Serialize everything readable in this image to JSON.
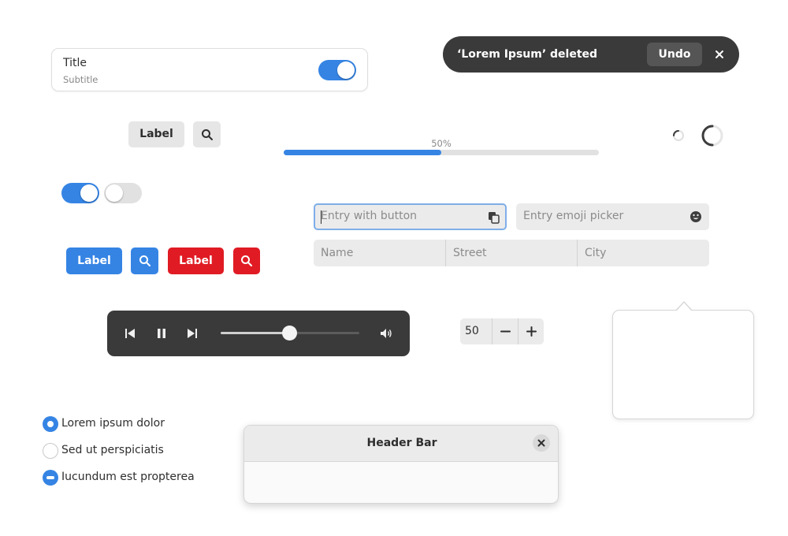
{
  "list_row": {
    "title": "Title",
    "subtitle": "Subtitle",
    "switch_on": true
  },
  "toast": {
    "message": "‘Lorem Ipsum’ deleted",
    "action_label": "Undo",
    "close_icon": "close-icon"
  },
  "flat_buttons": {
    "label": "Label",
    "icon": "search-icon"
  },
  "progress": {
    "label": "50%",
    "fraction": 0.5
  },
  "spinners": {
    "small": "spinner-small",
    "large": "spinner-large"
  },
  "switches": {
    "first_on": true,
    "second_on": false
  },
  "entries": {
    "with_button_placeholder": "Entry with button",
    "with_button_icon": "copy-icon",
    "emoji_placeholder": "Entry emoji picker",
    "emoji_icon": "emoji-icon"
  },
  "linked_entries": [
    "Name",
    "Street",
    "City"
  ],
  "suggested_buttons": {
    "label": "Label",
    "icon": "search-icon"
  },
  "destructive_buttons": {
    "label": "Label",
    "icon": "search-icon"
  },
  "media": {
    "icons": [
      "skip-back-icon",
      "pause-icon",
      "skip-forward-icon",
      "volume-icon"
    ],
    "position_fraction": 0.5
  },
  "spin_button": {
    "value": "50",
    "decrement": "minus-icon",
    "increment": "plus-icon"
  },
  "radios": [
    {
      "label": "Lorem ipsum dolor",
      "state": "checked"
    },
    {
      "label": "Sed ut perspiciatis",
      "state": "unchecked"
    },
    {
      "label": "Iucundum est propterea",
      "state": "mixed"
    }
  ],
  "header_bar": {
    "title": "Header Bar",
    "close_icon": "close-icon"
  },
  "colors": {
    "accent": "#3584e4",
    "destructive": "#e01b24",
    "dark_surface": "#3a3a3a"
  }
}
